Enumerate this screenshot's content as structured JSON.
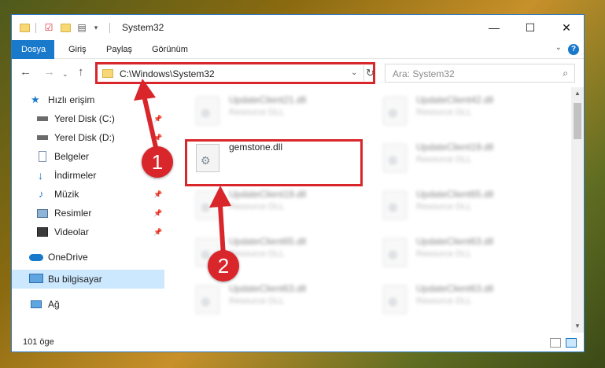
{
  "window": {
    "title": "System32",
    "controls": {
      "minimize": "—",
      "maximize": "☐",
      "close": "✕"
    }
  },
  "ribbon": {
    "tabs": [
      "Dosya",
      "Giriş",
      "Paylaş",
      "Görünüm"
    ],
    "active_tab": "Dosya",
    "help": "?"
  },
  "address_bar": {
    "path": "C:\\Windows\\System32"
  },
  "search": {
    "placeholder": "Ara: System32"
  },
  "sidebar": {
    "items": [
      {
        "label": "Hızlı erişim",
        "icon": "star-icon",
        "pinned": false
      },
      {
        "label": "Yerel Disk (C:)",
        "icon": "drive-icon",
        "pinned": true
      },
      {
        "label": "Yerel Disk (D:)",
        "icon": "drive-icon",
        "pinned": true
      },
      {
        "label": "Belgeler",
        "icon": "documents-icon",
        "pinned": true
      },
      {
        "label": "İndirmeler",
        "icon": "download-icon",
        "pinned": true
      },
      {
        "label": "Müzik",
        "icon": "music-icon",
        "pinned": true
      },
      {
        "label": "Resimler",
        "icon": "pictures-icon",
        "pinned": true
      },
      {
        "label": "Videolar",
        "icon": "videos-icon",
        "pinned": true
      },
      {
        "label": "OneDrive",
        "icon": "cloud-icon",
        "pinned": false
      },
      {
        "label": "Bu bilgisayar",
        "icon": "computer-icon",
        "pinned": false,
        "selected": true
      },
      {
        "label": "Ağ",
        "icon": "network-icon",
        "pinned": false
      }
    ]
  },
  "files": [
    {
      "name": "UpdateClient21.dll",
      "type": "Resource DLL",
      "highlighted": false
    },
    {
      "name": "UpdateClient42.dll",
      "type": "Resource DLL",
      "highlighted": false
    },
    {
      "name": "gemstone.dll",
      "type": "",
      "highlighted": true
    },
    {
      "name": "UpdateClient19.dll",
      "type": "Resource DLL",
      "highlighted": false
    },
    {
      "name": "UpdateClient19.dll",
      "type": "Resource DLL",
      "highlighted": false
    },
    {
      "name": "UpdateClient65.dll",
      "type": "Resource DLL",
      "highlighted": false
    },
    {
      "name": "UpdateClient65.dll",
      "type": "Resource DLL",
      "highlighted": false
    },
    {
      "name": "UpdateClient63.dll",
      "type": "Resource DLL",
      "highlighted": false
    },
    {
      "name": "UpdateClient63.dll",
      "type": "Resource DLL",
      "highlighted": false
    },
    {
      "name": "UpdateClient63.dll",
      "type": "Resource DLL",
      "highlighted": false
    }
  ],
  "status": {
    "item_count": "101 öge"
  },
  "annotations": {
    "step1": "1",
    "step2": "2",
    "color": "#d9262b"
  },
  "colors": {
    "accent": "#1979ca",
    "selected_bg": "#cce8ff",
    "annotation_red": "#d9262b"
  }
}
